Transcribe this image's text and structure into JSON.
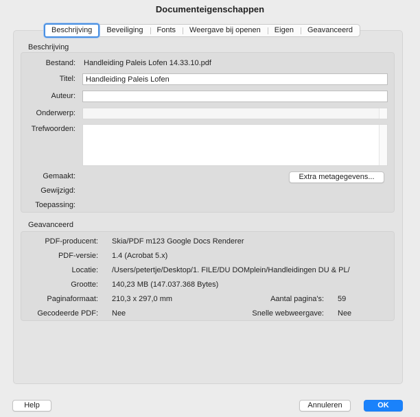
{
  "window": {
    "title": "Documenteigenschappen"
  },
  "tabs": [
    {
      "label": "Beschrijving",
      "active": true
    },
    {
      "label": "Beveiliging"
    },
    {
      "label": "Fonts"
    },
    {
      "label": "Weergave bij openen"
    },
    {
      "label": "Eigen"
    },
    {
      "label": "Geavanceerd"
    }
  ],
  "description": {
    "section_title": "Beschrijving",
    "file_label": "Bestand:",
    "file_value": "Handleiding Paleis Lofen 14.33.10.pdf",
    "title_label": "Titel:",
    "title_value": "Handleiding Paleis Lofen",
    "author_label": "Auteur:",
    "author_value": "",
    "subject_label": "Onderwerp:",
    "subject_value": "",
    "keywords_label": "Trefwoorden:",
    "keywords_value": "",
    "created_label": "Gemaakt:",
    "created_value": "",
    "modified_label": "Gewijzigd:",
    "modified_value": "",
    "application_label": "Toepassing:",
    "application_value": "",
    "extra_metadata_button": "Extra metagegevens..."
  },
  "advanced": {
    "section_title": "Geavanceerd",
    "producer_label": "PDF-producent:",
    "producer_value": "Skia/PDF m123 Google Docs Renderer",
    "version_label": "PDF-versie:",
    "version_value": "1.4 (Acrobat 5.x)",
    "location_label": "Locatie:",
    "location_value": "/Users/petertje/Desktop/1. FILE/DU DOMplein/Handleidingen DU & PL/",
    "size_label": "Grootte:",
    "size_value": "140,23 MB (147.037.368 Bytes)",
    "page_format_label": "Paginaformaat:",
    "page_format_value": "210,3 x 297,0 mm",
    "page_count_label": "Aantal pagina's:",
    "page_count_value": "59",
    "tagged_label": "Gecodeerde PDF:",
    "tagged_value": "Nee",
    "fast_web_label": "Snelle webweergave:",
    "fast_web_value": "Nee"
  },
  "buttons": {
    "help": "Help",
    "cancel": "Annuleren",
    "ok": "OK"
  },
  "colors": {
    "accent": "#1a82fb",
    "focus_ring": "#4a90e2",
    "window_bg": "#ececec"
  }
}
